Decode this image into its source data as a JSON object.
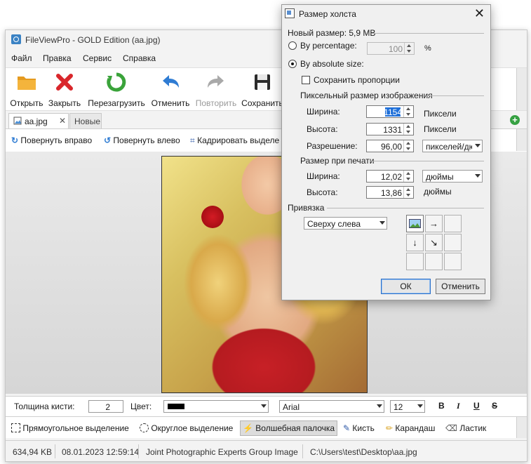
{
  "app": {
    "title": "FileViewPro - GOLD Edition (aa.jpg)"
  },
  "menu": [
    "Файл",
    "Правка",
    "Сервис",
    "Справка"
  ],
  "toolbar": {
    "open": "Открыть",
    "close": "Закрыть",
    "reload": "Перезагрузить",
    "undo": "Отменить",
    "redo": "Повторить",
    "save": "Сохранить"
  },
  "tabs": {
    "active": "aa.jpg",
    "new": "Новые"
  },
  "actions": {
    "rotate_right": "Повернуть вправо",
    "rotate_left": "Повернуть влево",
    "crop": "Кадрировать выделе"
  },
  "brush": {
    "thickness_label": "Толщина кисти:",
    "thickness_value": "2",
    "color_label": "Цвет:",
    "color_value": "#000000",
    "font": "Arial",
    "font_size": "12",
    "bold": "B",
    "italic": "I",
    "underline": "U",
    "strike": "S"
  },
  "selection_tools": {
    "rect": "Прямоугольное выделение",
    "round": "Округлое выделение",
    "magic": "Волшебная палочка",
    "brush": "Кисть",
    "pencil": "Карандаш",
    "eraser": "Ластик"
  },
  "status": {
    "size": "634,94 KB",
    "date": "08.01.2023 12:59:14",
    "type": "Joint Photographic Experts Group Image",
    "path": "C:\\Users\\test\\Desktop\\aa.jpg"
  },
  "dialog": {
    "title": "Размер холста",
    "new_size": "Новый размер: 5,9 MB",
    "by_percentage": "By percentage:",
    "percentage_value": "100",
    "percent_sign": "%",
    "by_absolute": "By absolute size:",
    "keep_proportions": "Сохранить пропорции",
    "pixel_section": "Пиксельный размер изображения",
    "width_label": "Ширина:",
    "width_value": "1154",
    "height_label": "Высота:",
    "height_value": "1331",
    "pixels": "Пиксели",
    "resolution_label": "Разрешение:",
    "resolution_value": "96,00",
    "resolution_unit": "пикселей/дюйм",
    "print_section": "Размер при печати",
    "print_width_label": "Ширина:",
    "print_width_value": "12,02",
    "print_width_unit": "дюймы",
    "print_height_label": "Высота:",
    "print_height_value": "13,86",
    "print_height_unit": "дюймы",
    "anchor_section": "Привязка",
    "anchor_value": "Сверху слева",
    "ok": "ОК",
    "cancel": "Отменить"
  }
}
